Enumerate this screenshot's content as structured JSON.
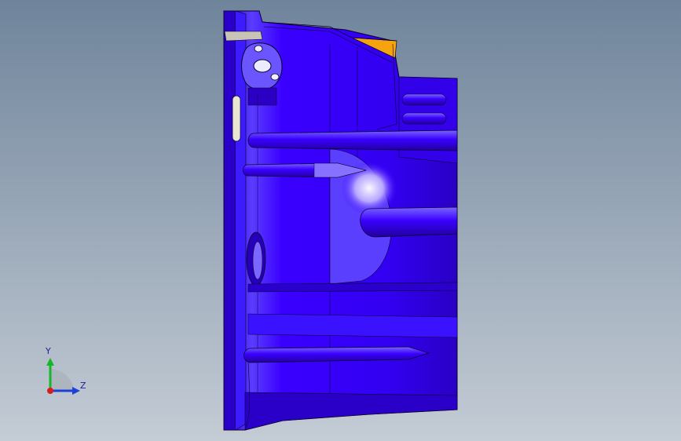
{
  "colors": {
    "background_top": "#6f849b",
    "background_bottom": "#c4ccd5",
    "part_primary": "#3b00ff",
    "part_dark": "#2200b8",
    "part_highlight": "#8e7bff",
    "part_specular": "#efe6ff",
    "edge_line": "#0a0028",
    "accent_face": "#f6a40e",
    "flange_grey": "#c9c4b5",
    "axis_x": "#d81b1b",
    "axis_y": "#17b52c",
    "axis_z": "#1e3fd8"
  },
  "triad": {
    "y_label": "Y",
    "z_label": "Z"
  }
}
